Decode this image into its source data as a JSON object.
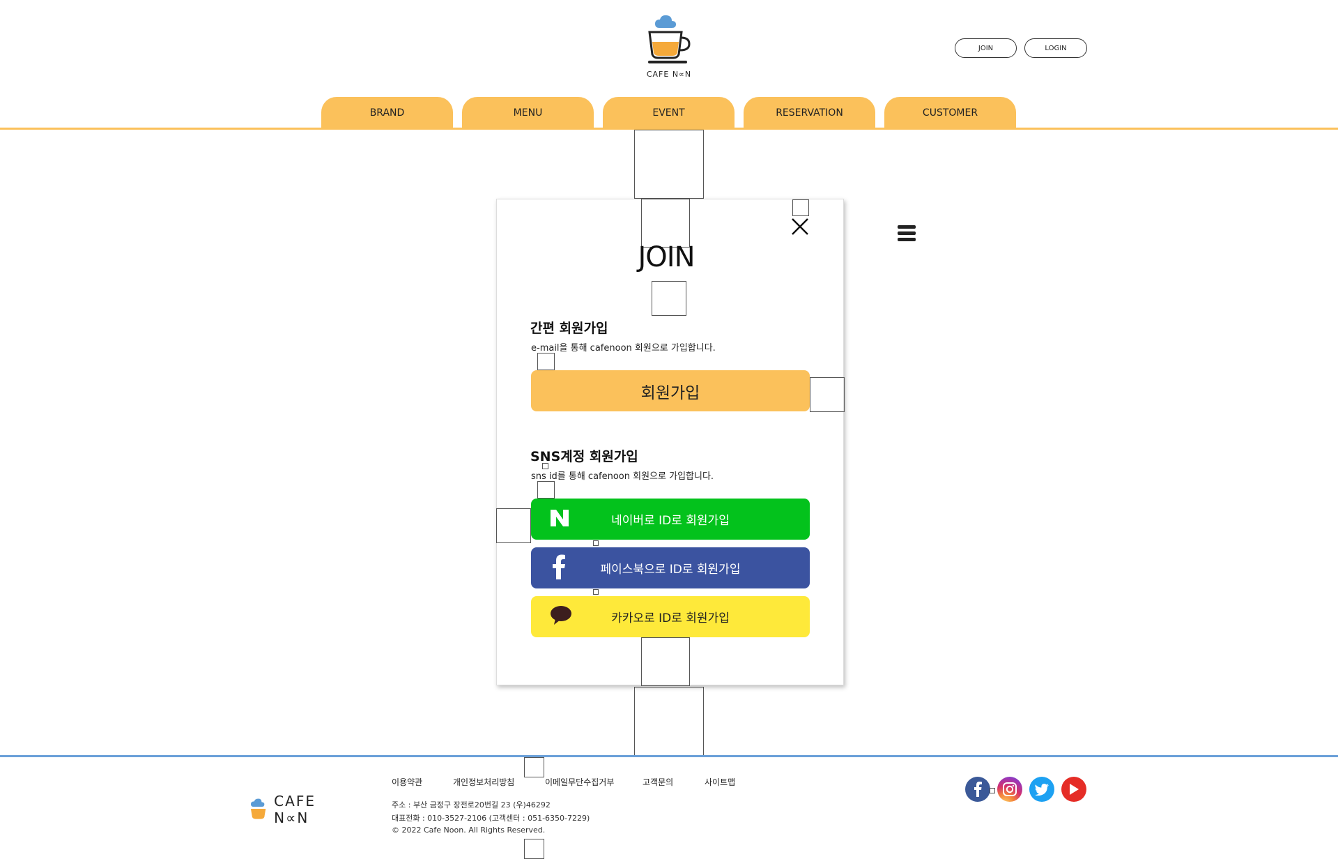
{
  "header": {
    "logo_text": "CAFE N∝N",
    "join_label": "JOIN",
    "login_label": "LOGIN"
  },
  "nav": {
    "items": [
      {
        "label": "BRAND"
      },
      {
        "label": "MENU"
      },
      {
        "label": "EVENT"
      },
      {
        "label": "RESERVATION"
      },
      {
        "label": "CUSTOMER"
      }
    ]
  },
  "modal": {
    "title": "JOIN",
    "simple": {
      "title": "간편 회원가입",
      "desc": "e-mail을 통해 cafenoon 회원으로 가입합니다.",
      "button": "회원가입"
    },
    "sns": {
      "title": "SNS계정 회원가입",
      "desc": "sns id를 통해 cafenoon 회원으로 가입합니다.",
      "naver": "네이버로  ID로 회원가입",
      "facebook": "페이스북으로  ID로 회원가입",
      "kakao": "카카오로 ID로 회원가입"
    }
  },
  "footer": {
    "logo_text": "CAFE N∝N",
    "links": [
      "이용약관",
      "개인정보처리방침",
      "이메일무단수집거부",
      "고객문의",
      "사이트맵"
    ],
    "address": "주소 : 부산 금정구 장전로20번길 23 (우)46292",
    "phone": "대표전화 : 010-3527-2106 (고객센터 : 051-6350-7229)",
    "copyright": "© 2022 Cafe Noon. All Rights Reserved."
  },
  "colors": {
    "accent": "#FBC15B",
    "footer_line": "#6A9FD8",
    "naver": "#03C21C",
    "facebook": "#3B53A0",
    "kakao": "#FEE93A"
  },
  "icons": {
    "logo": "coffee-cup-cloud-icon",
    "close": "close-icon",
    "menu": "hamburger-menu-icon",
    "social": [
      "facebook-icon",
      "instagram-icon",
      "twitter-icon",
      "youtube-icon"
    ]
  }
}
